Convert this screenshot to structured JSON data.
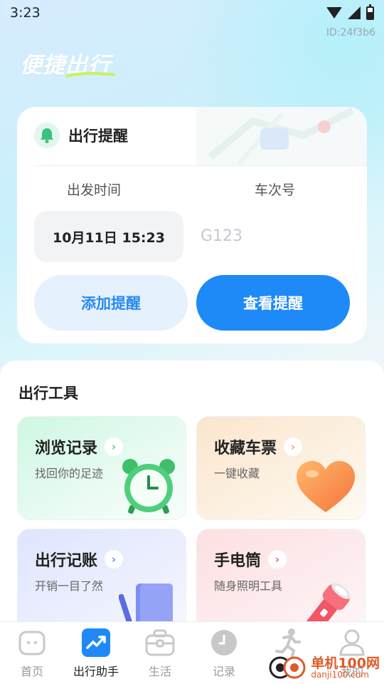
{
  "status_bar": {
    "time": "3:23"
  },
  "id_label": "ID:24f3b6",
  "brand": {
    "title": "便捷出行"
  },
  "reminder": {
    "title": "出行提醒",
    "depart_label": "出发时间",
    "train_label": "车次号",
    "depart_value": "10月11日 15:23",
    "train_placeholder": "G123",
    "train_value": "",
    "add_button": "添加提醒",
    "view_button": "查看提醒",
    "colors": {
      "primary": "#1e8af7",
      "secondary_bg": "#e5f1fd"
    }
  },
  "tools": {
    "title": "出行工具",
    "items": [
      {
        "title": "浏览记录",
        "subtitle": "找回你的足迹",
        "icon": "alarm-clock-icon",
        "accent": "#4fc97a"
      },
      {
        "title": "收藏车票",
        "subtitle": "一键收藏",
        "icon": "heart-icon",
        "accent": "#f7a94c"
      },
      {
        "title": "出行记账",
        "subtitle": "开销一目了然",
        "icon": "notebook-icon",
        "accent": "#6f82f0"
      },
      {
        "title": "手电筒",
        "subtitle": "随身照明工具",
        "icon": "flashlight-icon",
        "accent": "#f25563"
      }
    ]
  },
  "nav": {
    "items": [
      {
        "label": "首页",
        "icon": "home-icon",
        "active": false
      },
      {
        "label": "出行助手",
        "icon": "trend-icon",
        "active": true
      },
      {
        "label": "生活",
        "icon": "briefcase-icon",
        "active": false
      },
      {
        "label": "记录",
        "icon": "clock-icon",
        "active": false
      },
      {
        "label": "运动",
        "icon": "runner-icon",
        "active": false
      },
      {
        "label": "我的",
        "icon": "user-icon",
        "active": false
      }
    ],
    "active_color": "#1e8af7"
  },
  "watermark": {
    "name": "单机100网",
    "url": "danji100.com"
  }
}
